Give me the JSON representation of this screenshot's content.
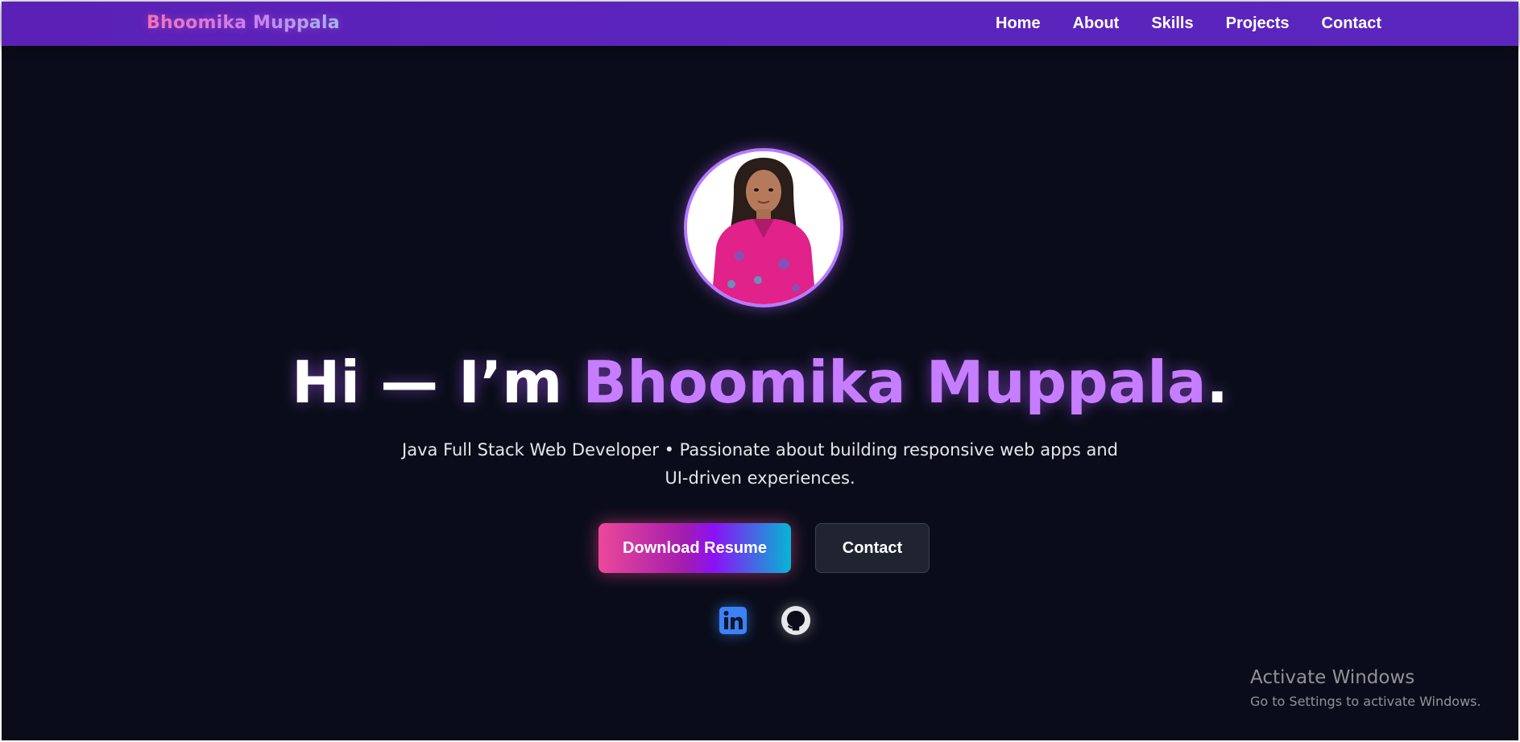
{
  "navbar": {
    "brand": "Bhoomika Muppala",
    "links": [
      "Home",
      "About",
      "Skills",
      "Projects",
      "Contact"
    ]
  },
  "hero": {
    "avatar_alt": "Bhoomika Muppala profile photo",
    "headline_prefix": "Hi — I’m ",
    "headline_name": "Bhoomika Muppala",
    "headline_suffix": ".",
    "subtitle_line1": "Java Full Stack Web Developer • Passionate about building responsive web apps and",
    "subtitle_line2": "UI-driven experiences.",
    "primary_button": "Download Resume",
    "secondary_button": "Contact",
    "social": [
      {
        "name": "linkedin-icon",
        "color": "#3b82f6"
      },
      {
        "name": "github-icon",
        "color": "#e5e7eb"
      }
    ]
  },
  "watermark": {
    "title": "Activate Windows",
    "subtitle": "Go to Settings to activate Windows."
  },
  "colors": {
    "navbar": "#5b21b6",
    "background": "#0a0d19",
    "accent": "#c77dff",
    "button_gradient": [
      "#ec4899",
      "#8b11f5",
      "#06b6d4"
    ],
    "secondary_button": "#1f2430"
  }
}
